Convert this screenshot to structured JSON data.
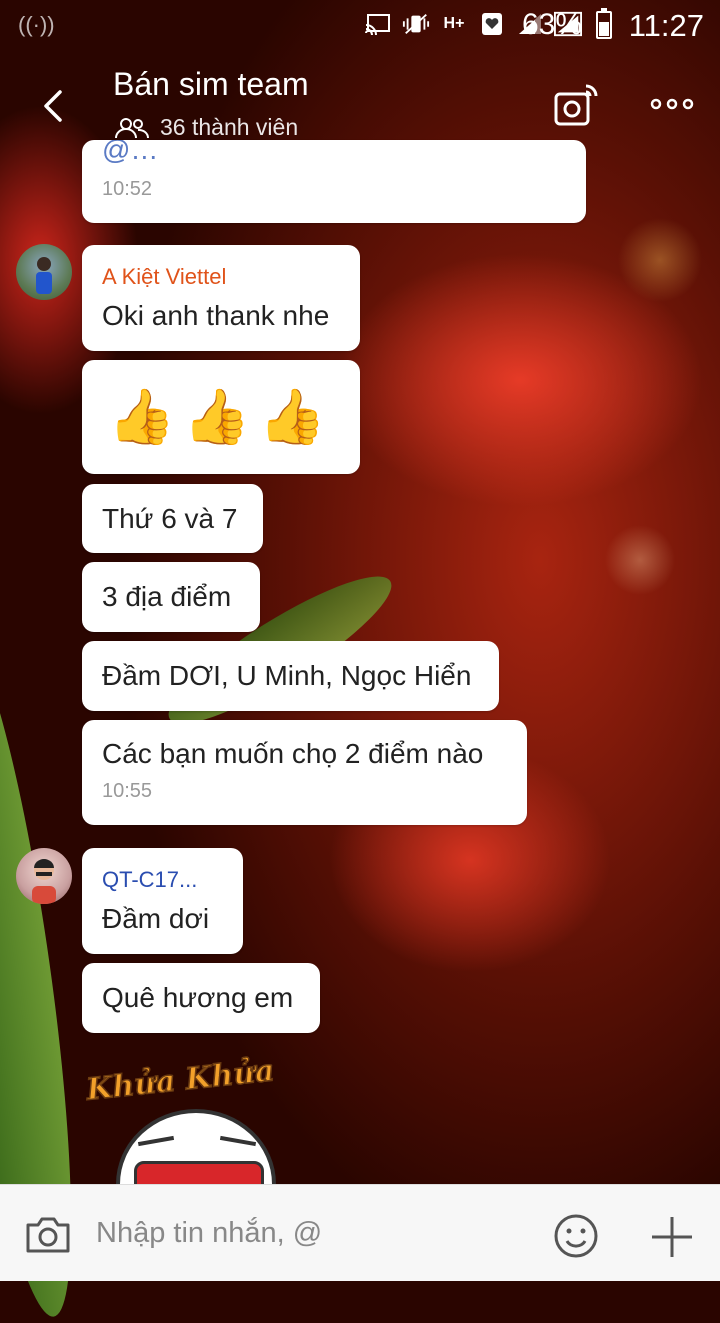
{
  "status_bar": {
    "battery": "63%",
    "time": "11:27",
    "network": "H+"
  },
  "header": {
    "title": "Bán sim team",
    "members": "36 thành viên"
  },
  "messages": [
    {
      "text": "@…",
      "time": "10:52"
    },
    {
      "sender": "A Kiệt Viettel",
      "text": "Oki anh thank nhe"
    },
    {
      "sticker": "👍👍👍"
    },
    {
      "text": "Thứ 6 và 7"
    },
    {
      "text": "3 địa điểm"
    },
    {
      "text": "Đầm DƠI, U Minh, Ngọc Hiển"
    },
    {
      "text": "Các bạn muốn chọ 2 điểm nào",
      "time": "10:55"
    },
    {
      "sender": "QT-C17...",
      "text": "Đầm dơi"
    },
    {
      "text": "Quê hương em"
    }
  ],
  "sticker_text": "Khửa Khửa",
  "input": {
    "placeholder": "Nhập tin nhắn, @"
  },
  "colors": {
    "sender_orange": "#e0531a",
    "sender_blue": "#2a4db0",
    "bubble_bg": "#ffffff"
  }
}
